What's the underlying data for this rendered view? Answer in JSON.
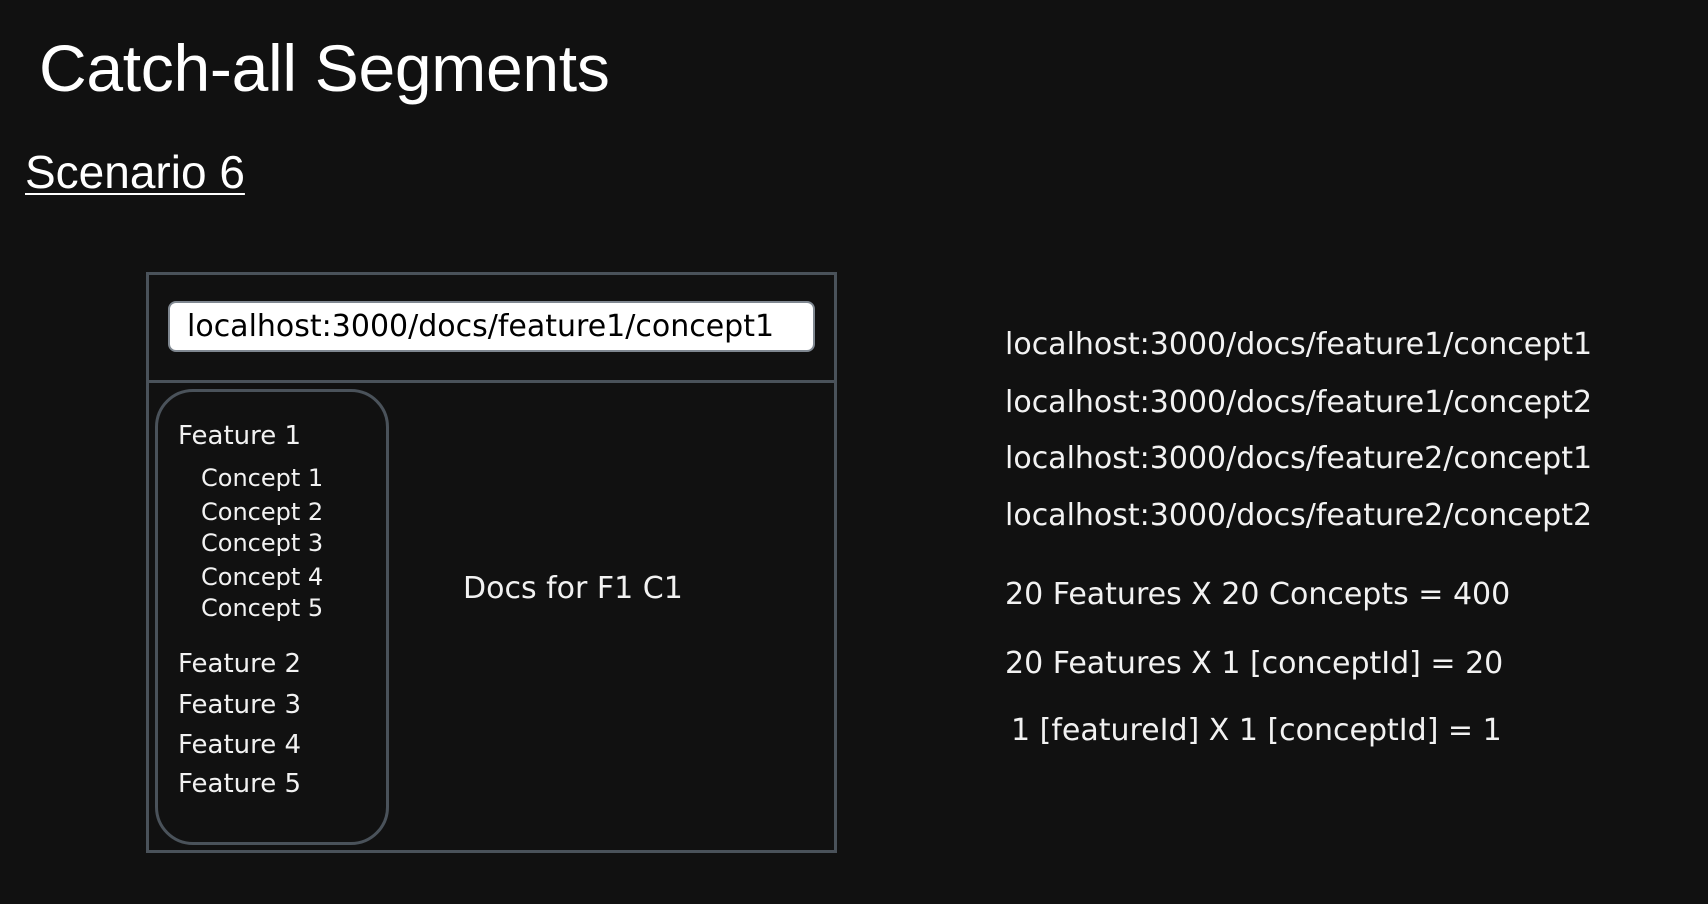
{
  "slide": {
    "title": "Catch-all Segments",
    "scenario": "Scenario 6"
  },
  "browser": {
    "url": "localhost:3000/docs/feature1/concept1",
    "content": "Docs for F1 C1",
    "sidebar": {
      "feature_1": "Feature 1",
      "concepts": [
        "Concept 1",
        "Concept 2",
        "Concept 3",
        "Concept 4",
        "Concept 5"
      ],
      "other_features": [
        "Feature 2",
        "Feature 3",
        "Feature 4",
        "Feature 5"
      ]
    }
  },
  "routes": [
    "localhost:3000/docs/feature1/concept1",
    "localhost:3000/docs/feature1/concept2",
    "localhost:3000/docs/feature2/concept1",
    "localhost:3000/docs/feature2/concept2"
  ],
  "calculations": [
    "20 Features X 20 Concepts = 400",
    "20 Features X 1 [conceptId] = 20",
    "1 [featureId] X 1 [conceptId] = 1"
  ]
}
